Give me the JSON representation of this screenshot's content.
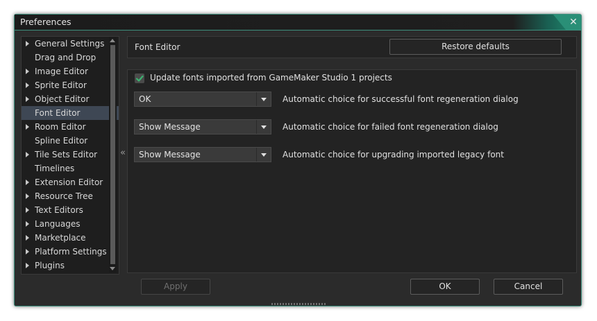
{
  "window": {
    "title": "Preferences",
    "close_glyph": "✕",
    "accent_color": "#2a8f77"
  },
  "sidebar": {
    "items": [
      {
        "label": "General Settings",
        "expandable": true
      },
      {
        "label": "Drag and Drop",
        "expandable": false
      },
      {
        "label": "Image Editor",
        "expandable": true
      },
      {
        "label": "Sprite Editor",
        "expandable": true
      },
      {
        "label": "Object Editor",
        "expandable": true
      },
      {
        "label": "Font Editor",
        "expandable": false,
        "selected": true
      },
      {
        "label": "Room Editor",
        "expandable": true
      },
      {
        "label": "Spline Editor",
        "expandable": false
      },
      {
        "label": "Tile Sets Editor",
        "expandable": true
      },
      {
        "label": "Timelines",
        "expandable": false
      },
      {
        "label": "Extension Editor",
        "expandable": true
      },
      {
        "label": "Resource Tree",
        "expandable": true
      },
      {
        "label": "Text Editors",
        "expandable": true
      },
      {
        "label": "Languages",
        "expandable": true
      },
      {
        "label": "Marketplace",
        "expandable": true
      },
      {
        "label": "Platform Settings",
        "expandable": true
      },
      {
        "label": "Plugins",
        "expandable": true
      }
    ],
    "collapse_glyph": "«"
  },
  "header": {
    "section_title": "Font Editor",
    "restore_label": "Restore defaults"
  },
  "content": {
    "checkbox": {
      "label": "Update fonts imported from GameMaker Studio 1 projects",
      "checked": true,
      "check_color": "#3cb371"
    },
    "rows": [
      {
        "value": "OK",
        "description": "Automatic choice for successful font regeneration dialog"
      },
      {
        "value": "Show Message",
        "description": "Automatic choice for failed font regeneration dialog"
      },
      {
        "value": "Show Message",
        "description": "Automatic choice for upgrading imported legacy font"
      }
    ]
  },
  "footer": {
    "apply_label": "Apply",
    "ok_label": "OK",
    "cancel_label": "Cancel"
  }
}
